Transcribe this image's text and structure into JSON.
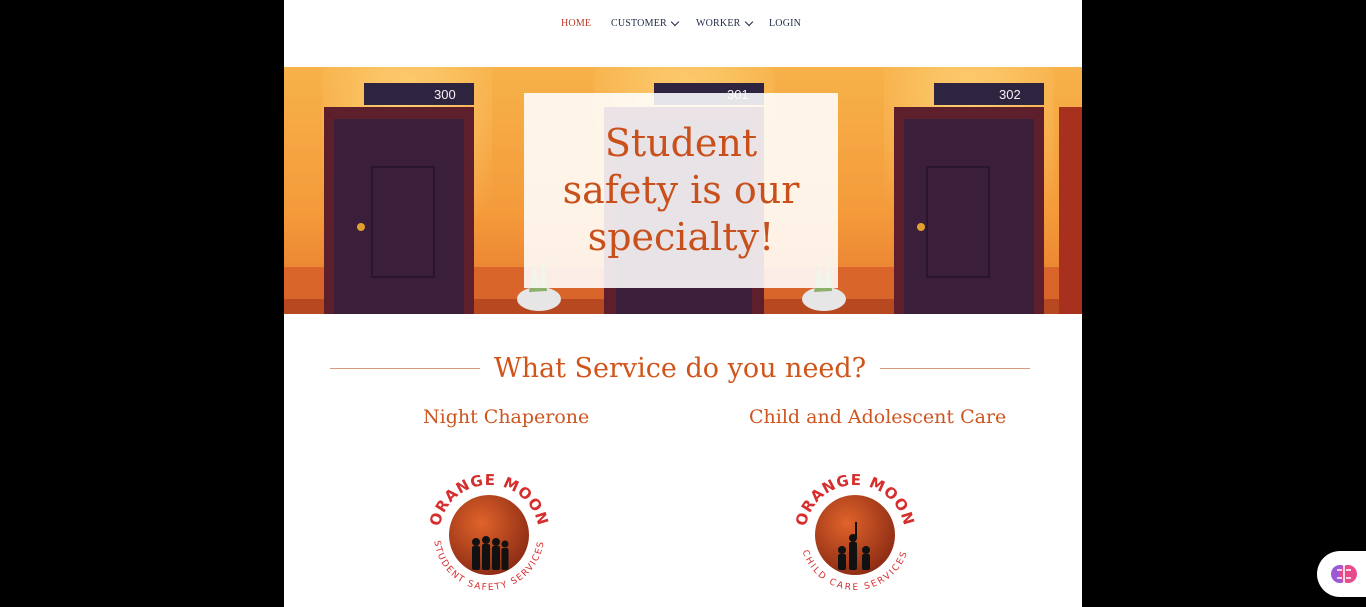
{
  "nav": {
    "items": [
      {
        "label": "HOME",
        "active": true,
        "dropdown": false
      },
      {
        "label": "CUSTOMER",
        "active": false,
        "dropdown": true
      },
      {
        "label": "WORKER",
        "active": false,
        "dropdown": true
      },
      {
        "label": "LOGIN",
        "active": false,
        "dropdown": false
      }
    ]
  },
  "hero": {
    "title": "Student safety is our specialty!",
    "door_numbers": [
      "300",
      "301",
      "302"
    ]
  },
  "services": {
    "heading": "What Service do you need?",
    "items": [
      {
        "label": "Night Chaperone",
        "logo_top_text": "ORANGE MOON",
        "logo_bottom_text": "STUDENT SAFETY SERVICES"
      },
      {
        "label": "Child and Adolescent Care",
        "logo_top_text": "ORANGE MOON",
        "logo_bottom_text": "CHILD CARE SERVICES"
      }
    ]
  },
  "colors": {
    "accent": "#c94f1b",
    "nav_active": "#c0392b",
    "nav_text": "#1d2a44",
    "background": "#000000"
  },
  "icons": {
    "assistant": "brain-icon"
  }
}
